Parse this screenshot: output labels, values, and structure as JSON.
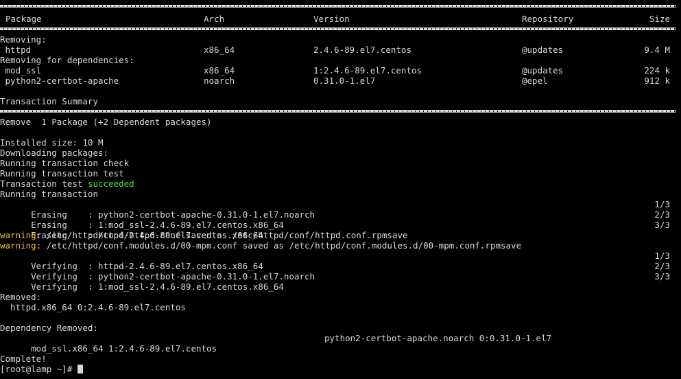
{
  "header": {
    "package": "Package",
    "arch": "Arch",
    "version": "Version",
    "repository": "Repository",
    "size": "Size"
  },
  "removing_label": "Removing:",
  "removing": [
    {
      "package": " httpd",
      "arch": "x86_64",
      "version": "2.4.6-89.el7.centos",
      "repository": "@updates",
      "size": "9.4 M"
    }
  ],
  "deps_label": "Removing for dependencies:",
  "deps": [
    {
      "package": " mod_ssl",
      "arch": "x86_64",
      "version": "1:2.4.6-89.el7.centos",
      "repository": "@updates",
      "size": "224 k"
    },
    {
      "package": " python2-certbot-apache",
      "arch": "noarch",
      "version": "0.31.0-1.el7",
      "repository": "@epel",
      "size": "912 k"
    }
  ],
  "summary": {
    "title": "Transaction Summary",
    "remove_line": "Remove  1 Package (+2 Dependent packages)"
  },
  "log": {
    "installed_size": "Installed size: 10 M",
    "downloading": "Downloading packages:",
    "check": "Running transaction check",
    "test": "Running transaction test",
    "test_result_prefix": "Transaction test ",
    "test_result_status": "succeeded",
    "running": "Running transaction"
  },
  "erasing": [
    {
      "text": "  Erasing    : python2-certbot-apache-0.31.0-1.el7.noarch",
      "progress": "1/3"
    },
    {
      "text": "  Erasing    : 1:mod_ssl-2.4.6-89.el7.centos.x86_64",
      "progress": "2/3"
    },
    {
      "text": "  Erasing    : httpd-2.4.6-89.el7.centos.x86_64",
      "progress": "3/3"
    }
  ],
  "warnings": [
    {
      "label": "warning",
      "text": ": /etc/httpd/conf/httpd.conf saved as /etc/httpd/conf/httpd.conf.rpmsave"
    },
    {
      "label": "warning",
      "text": ": /etc/httpd/conf.modules.d/00-mpm.conf saved as /etc/httpd/conf.modules.d/00-mpm.conf.rpmsave"
    }
  ],
  "verifying": [
    {
      "text": "  Verifying  : httpd-2.4.6-89.el7.centos.x86_64",
      "progress": "1/3"
    },
    {
      "text": "  Verifying  : python2-certbot-apache-0.31.0-1.el7.noarch",
      "progress": "2/3"
    },
    {
      "text": "  Verifying  : 1:mod_ssl-2.4.6-89.el7.centos.x86_64",
      "progress": "3/3"
    }
  ],
  "removed": {
    "label": "Removed:",
    "item": "  httpd.x86_64 0:2.4.6-89.el7.centos"
  },
  "dependency_removed": {
    "label": "Dependency Removed:",
    "item1": "  mod_ssl.x86_64 1:2.4.6-89.el7.centos",
    "item2": "python2-certbot-apache.noarch 0:0.31.0-1.el7"
  },
  "complete": "Complete!",
  "prompt": "[root@lamp ~]# ",
  "colors": {
    "background": "#000000",
    "text": "#d8d8d8",
    "success": "#4ddb4d",
    "warning": "#e6c229"
  }
}
